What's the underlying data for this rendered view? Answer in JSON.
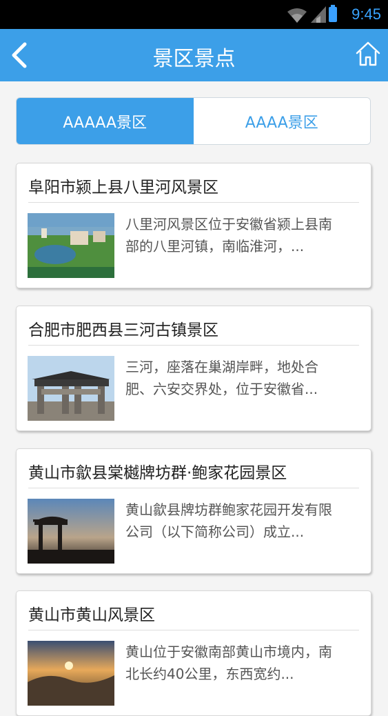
{
  "status_bar": {
    "time": "9:45"
  },
  "header": {
    "title": "景区景点"
  },
  "tabs": [
    {
      "label": "AAAAA景区",
      "active": true
    },
    {
      "label": "AAAA景区",
      "active": false
    }
  ],
  "spots": [
    {
      "title": "阜阳市颍上县八里河风景区",
      "desc_line1": "八里河风景区位于安徽省颍上县南",
      "desc_line2": "部的八里河镇，南临淮河，..."
    },
    {
      "title": "合肥市肥西县三河古镇景区",
      "desc_line1": "三河，座落在巢湖岸畔，地处合",
      "desc_line2": "肥、六安交界处，位于安徽省..."
    },
    {
      "title": "黄山市歙县棠樾牌坊群·鲍家花园景区",
      "desc_line1": "黄山歙县牌坊群鲍家花园开发有限",
      "desc_line2": "公司（以下简称公司）成立..."
    },
    {
      "title": "黄山市黄山风景区",
      "desc_line1": "黄山位于安徽南部黄山市境内，南",
      "desc_line2": "北长约40公里，东西宽约..."
    }
  ],
  "colors": {
    "accent": "#3c9fe8",
    "status_bar": "#000000"
  }
}
